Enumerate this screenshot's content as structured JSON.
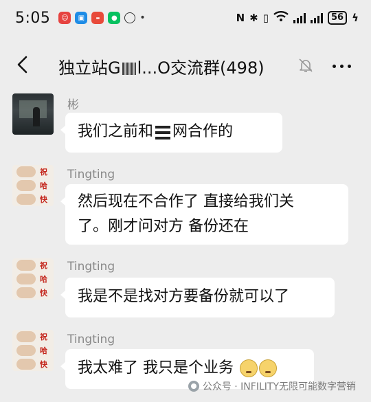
{
  "status_bar": {
    "time": "5:05",
    "battery": "56",
    "network": "6"
  },
  "header": {
    "title_prefix": "独立站",
    "title_mid": "G",
    "title_suffix": "l...O交流群(498)"
  },
  "messages": [
    {
      "sender": "彬",
      "avatar": "avatar-bin",
      "text_before": "我们之前和",
      "text_after": "网合作的"
    },
    {
      "sender": "Tingting",
      "avatar": "avatar-tingting",
      "line1": "然后现在不合作了 直接给我们关",
      "line2": "了。刚才问对方 备份还在"
    },
    {
      "sender": "Tingting",
      "avatar": "avatar-tingting",
      "line1": "我是不是找对方要备份就可以了"
    },
    {
      "sender": "Tingting",
      "avatar": "avatar-tingting",
      "line1": "我太难了 我只是个业务"
    }
  ],
  "avatar_text": [
    "祝",
    "哈",
    "快"
  ],
  "watermark": "公众号 · INFILITY无限可能数字营销",
  "icons": [
    "back-arrow-icon",
    "mute-bell-icon",
    "more-dots-icon",
    "wifi-icon",
    "bluetooth-icon",
    "signal-icon",
    "battery-icon"
  ]
}
